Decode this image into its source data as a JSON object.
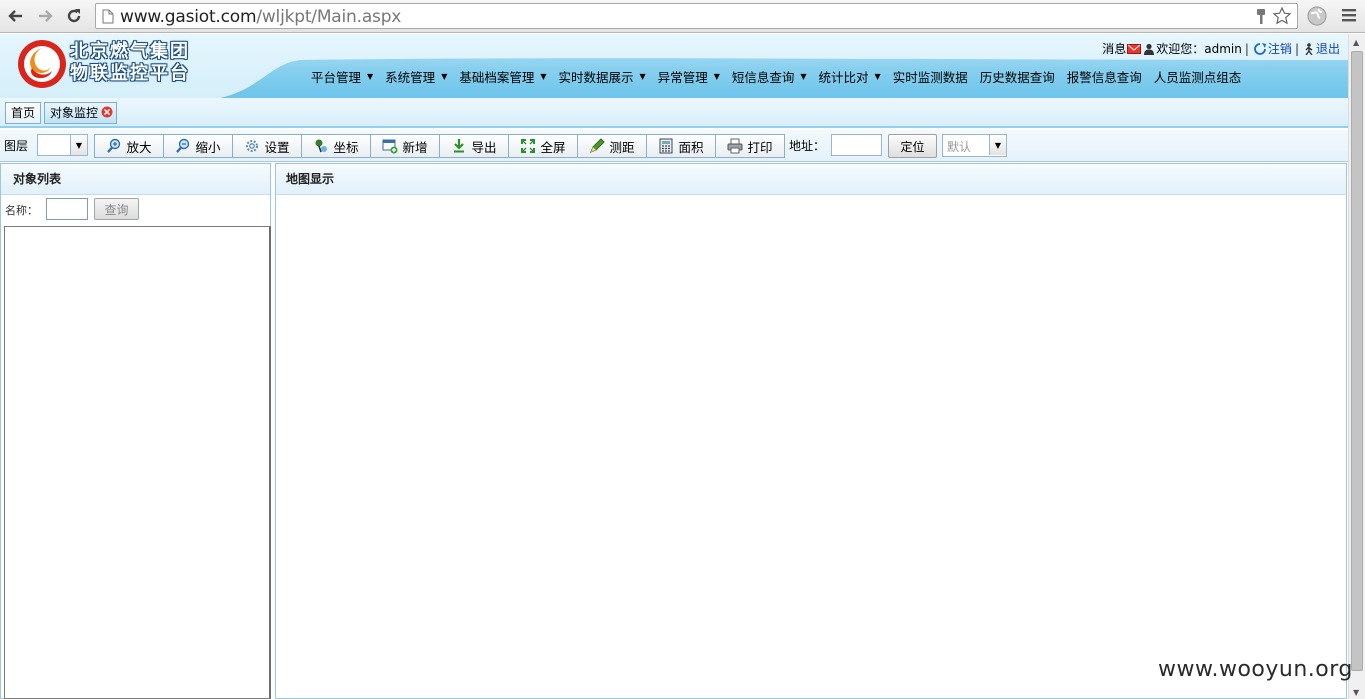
{
  "browser": {
    "url_host": "www.gasiot.com",
    "url_path": "/wljkpt/Main.aspx"
  },
  "header": {
    "logo_line1": "北京燃气集团",
    "logo_line2": "物联监控平台",
    "message_label": "消息",
    "welcome_label": "欢迎您：admin",
    "separator": "|",
    "logout_label": "注销",
    "exit_label": "退出"
  },
  "menu": [
    {
      "label": "平台管理",
      "has_dropdown": true
    },
    {
      "label": "系统管理",
      "has_dropdown": true
    },
    {
      "label": "基础档案管理",
      "has_dropdown": true
    },
    {
      "label": "实时数据展示",
      "has_dropdown": true
    },
    {
      "label": "异常管理",
      "has_dropdown": true
    },
    {
      "label": "短信息查询",
      "has_dropdown": true
    },
    {
      "label": "统计比对",
      "has_dropdown": true
    },
    {
      "label": "实时监测数据",
      "has_dropdown": false
    },
    {
      "label": "历史数据查询",
      "has_dropdown": false
    },
    {
      "label": "报警信息查询",
      "has_dropdown": false
    },
    {
      "label": "人员监测点组态",
      "has_dropdown": false
    }
  ],
  "tabs": {
    "home": "首页",
    "active": "对象监控"
  },
  "toolbar": {
    "layer_label": "图层",
    "buttons": {
      "zoom_in": "放大",
      "zoom_out": "缩小",
      "settings": "设置",
      "coordinate": "坐标",
      "add": "新增",
      "export": "导出",
      "fullscreen": "全屏",
      "measure": "测距",
      "area": "面积",
      "print": "打印"
    },
    "address_label": "地址：",
    "locate_button": "定位",
    "default_select": "默认"
  },
  "left_panel": {
    "title": "对象列表",
    "name_label": "名称：",
    "query_button": "查询"
  },
  "right_panel": {
    "title": "地图显示"
  },
  "watermark": "www.wooyun.org",
  "colors": {
    "header_gradient_top": "#d9f1fb",
    "header_gradient_bottom": "#66c1ea",
    "link_blue": "#1445b8",
    "panel_border": "#9ec6e0"
  }
}
